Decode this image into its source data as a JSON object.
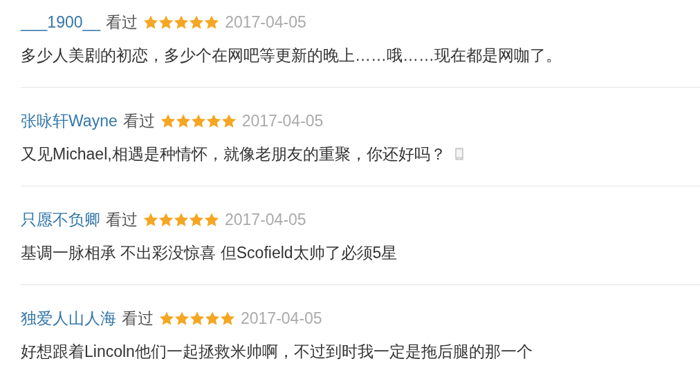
{
  "reviews": [
    {
      "user": "___1900__",
      "status": "看过",
      "stars": 5,
      "date": "2017-04-05",
      "text": "多少人美剧的初恋，多少个在网吧等更新的晚上……哦……现在都是网咖了。",
      "mobile": false
    },
    {
      "user": "张咏轩Wayne",
      "status": "看过",
      "stars": 5,
      "date": "2017-04-05",
      "text": "又见Michael,相遇是种情怀，就像老朋友的重聚，你还好吗？",
      "mobile": true
    },
    {
      "user": "只愿不负卿",
      "status": "看过",
      "stars": 5,
      "date": "2017-04-05",
      "text": "基调一脉相承 不出彩没惊喜 但Scofield太帅了必须5星",
      "mobile": false
    },
    {
      "user": "独爱人山人海",
      "status": "看过",
      "stars": 5,
      "date": "2017-04-05",
      "text": "好想跟着Lincoln他们一起拯救米帅啊，不过到时我一定是拖后腿的那一个",
      "mobile": false
    }
  ]
}
